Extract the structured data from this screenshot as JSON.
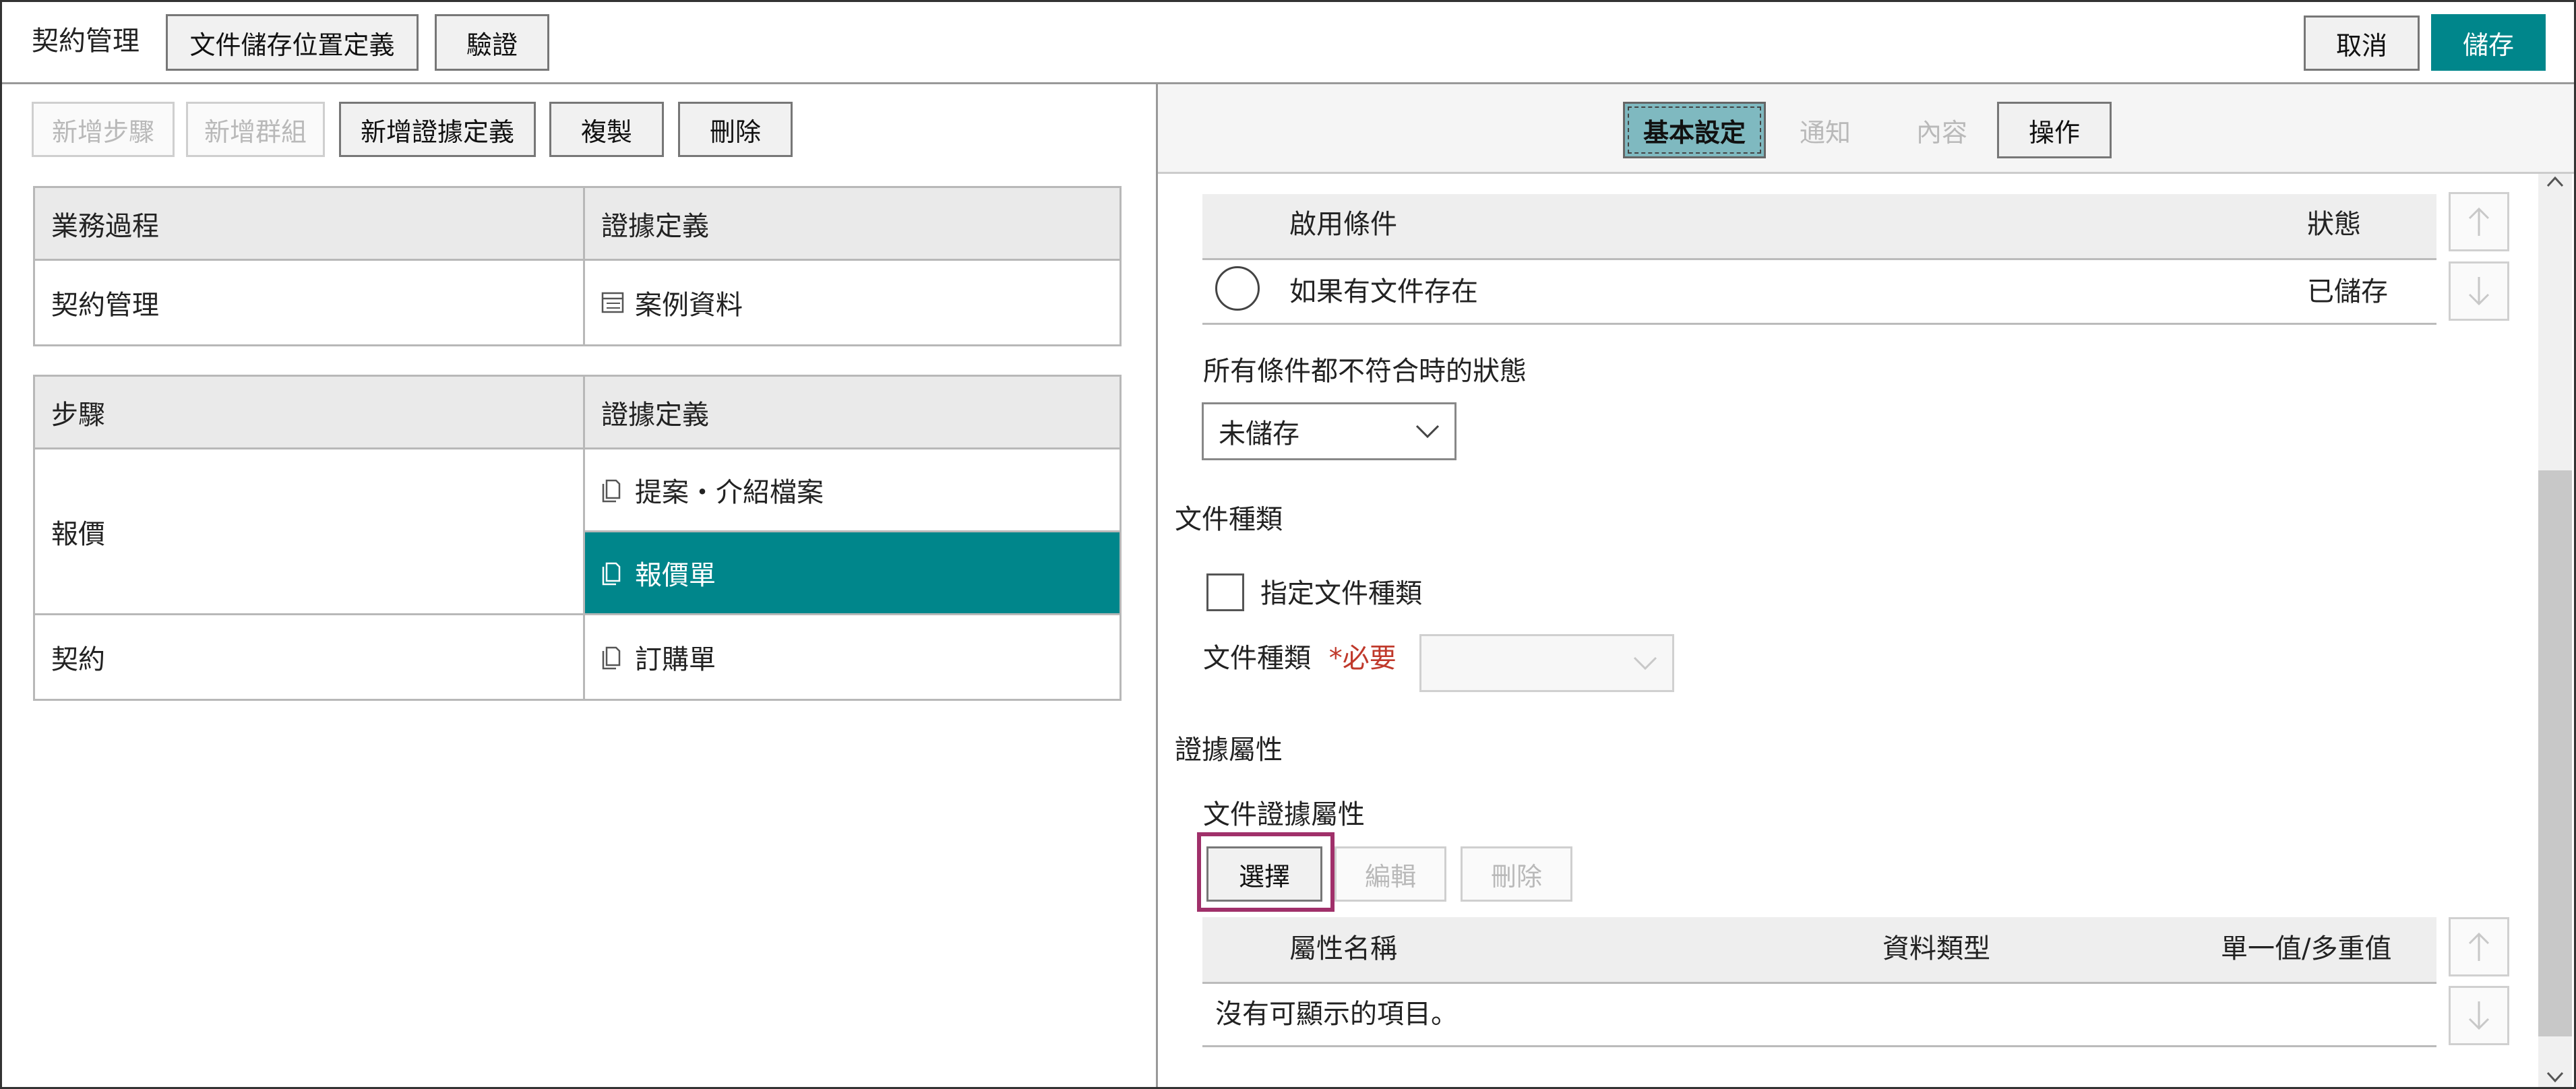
{
  "header": {
    "title": "契約管理",
    "buttons": {
      "doc_location": "文件儲存位置定義",
      "verify": "驗證",
      "cancel": "取消",
      "save": "儲存"
    }
  },
  "left": {
    "toolbar": {
      "add_step": "新增步驟",
      "add_group": "新增群組",
      "add_evidence": "新增證據定義",
      "copy": "複製",
      "delete": "刪除"
    },
    "process_table": {
      "headers": [
        "業務過程",
        "證據定義"
      ],
      "row": {
        "process": "契約管理",
        "evidence": "案例資料"
      }
    },
    "step_table": {
      "headers": [
        "步驟",
        "證據定義"
      ],
      "rows": [
        {
          "step": "報價",
          "evidence": [
            "提案・介紹檔案",
            "報價單"
          ]
        },
        {
          "step": "契約",
          "evidence": [
            "訂購單"
          ]
        }
      ]
    }
  },
  "right": {
    "tabs": {
      "basic": "基本設定",
      "notify": "通知",
      "content": "內容",
      "operation": "操作"
    },
    "conditions": {
      "col_condition": "啟用條件",
      "col_status": "狀態",
      "row_condition": "如果有文件存在",
      "row_status": "已儲存"
    },
    "fallback": {
      "label": "所有條件都不符合時的狀態",
      "value": "未儲存"
    },
    "doc_type": {
      "section": "文件種類",
      "checkbox_label": "指定文件種類",
      "field_label": "文件種類",
      "required": "*必要",
      "value": ""
    },
    "evidence_attr": {
      "section": "證據屬性",
      "sub_label": "文件證據屬性",
      "select_btn": "選擇",
      "edit_btn": "編輯",
      "delete_btn": "刪除",
      "headers": [
        "屬性名稱",
        "資料類型",
        "單一值/多重值"
      ],
      "empty_text": "沒有可顯示的項目。"
    }
  },
  "colors": {
    "accent": "#00868b",
    "highlight_box": "#a0306a",
    "required": "#c0392b"
  }
}
